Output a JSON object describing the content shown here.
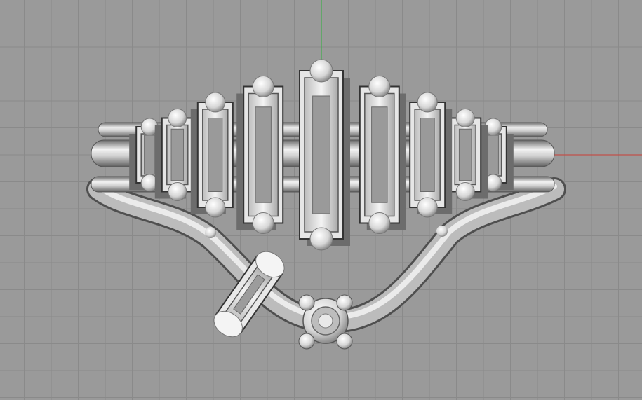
{
  "viewport": {
    "background_color": "#9a9a9a",
    "grid_color": "#8a8a8a",
    "grid_visible": true,
    "x_axis_color": "#c0504a",
    "y_axis_color": "#3fae4a",
    "model_color": "#d8d8d8",
    "model_shadow_color": "#5a5a5a",
    "shading": "rendered"
  },
  "model": {
    "name_icon": "jewelry-ring-icon",
    "baguette_stones": 9,
    "round_stone_settings": 1,
    "side_baguette_settings": 1
  }
}
